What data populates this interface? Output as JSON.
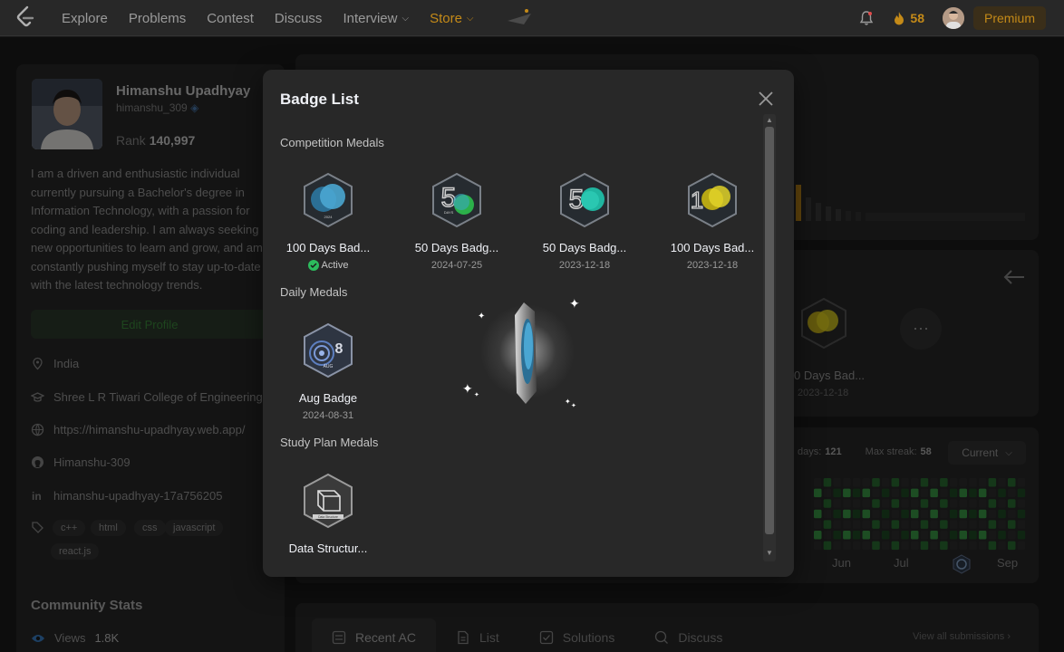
{
  "nav": {
    "links": [
      "Explore",
      "Problems",
      "Contest",
      "Discuss",
      "Interview",
      "Store"
    ],
    "streak": "58",
    "premium": "Premium"
  },
  "profile": {
    "name": "Himanshu Upadhyay",
    "handle": "himanshu_309",
    "rank_label": "Rank",
    "rank_value": "140,997",
    "bio": "I am a driven and enthusiastic individual currently pursuing a Bachelor's degree in Information Technology, with a passion for coding and leadership. I am always seeking new opportunities to learn and grow, and am constantly pushing myself to stay up-to-date with the latest technology trends.",
    "edit_profile": "Edit Profile",
    "location": "India",
    "college": "Shree L R Tiwari College of Engineering",
    "website": "https://himanshu-upadhyay.web.app/",
    "github": "Himanshu-309",
    "linkedin": "himanshu-upadhyay-17a756205",
    "skills": [
      "c++",
      "html",
      "css",
      "javascript",
      "react.js"
    ],
    "community_title": "Community Stats",
    "views_label": "Views",
    "views_value": "1.8K"
  },
  "background_panel": {
    "badge_name": "0 Days Bad...",
    "badge_date": "2023-12-18",
    "active_days_label": "days:",
    "active_days_value": "121",
    "max_streak_label": "Max streak:",
    "max_streak_value": "58",
    "dropdown": "Current",
    "months": [
      "Jun",
      "Jul",
      "Sep"
    ],
    "tabs": [
      "Recent AC",
      "List",
      "Solutions",
      "Discuss"
    ],
    "view_all": "View all submissions"
  },
  "modal": {
    "title": "Badge List",
    "sections": {
      "competition": "Competition Medals",
      "daily": "Daily Medals",
      "study": "Study Plan Medals"
    },
    "competition_badges": [
      {
        "name": "100 Days Bad...",
        "sub": "Active"
      },
      {
        "name": "50 Days Badg...",
        "sub": "2024-07-25"
      },
      {
        "name": "50 Days Badg...",
        "sub": "2023-12-18"
      },
      {
        "name": "100 Days Bad...",
        "sub": "2023-12-18"
      }
    ],
    "daily_badges": [
      {
        "name": "Aug Badge",
        "sub": "2024-08-31"
      }
    ],
    "study_badges": [
      {
        "name": "Data Structur...",
        "sub": ""
      }
    ]
  }
}
